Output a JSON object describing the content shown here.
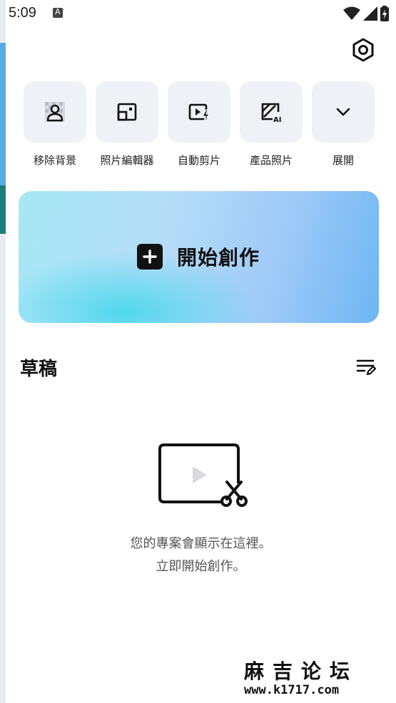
{
  "status_bar": {
    "time": "5:09"
  },
  "quick_actions": [
    {
      "label": "移除背景",
      "icon": "remove-background-icon"
    },
    {
      "label": "照片編輯器",
      "icon": "photo-editor-icon"
    },
    {
      "label": "自動剪片",
      "icon": "auto-cut-icon"
    },
    {
      "label": "產品照片",
      "icon": "product-photo-ai-icon"
    },
    {
      "label": "展開",
      "icon": "chevron-down-icon"
    }
  ],
  "create_card": {
    "label": "開始創作"
  },
  "drafts": {
    "title": "草稿",
    "empty_line1": "您的專案會顯示在這裡。",
    "empty_line2": "立即開始創作。"
  },
  "watermark": {
    "cn": "麻吉论坛",
    "url": "www.k1717.com"
  },
  "colors": {
    "card_start": "#a6e8f5",
    "card_end": "#6eb6f3",
    "tile_bg": "#eef1f5"
  }
}
